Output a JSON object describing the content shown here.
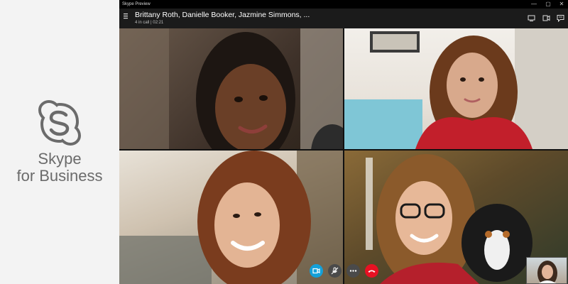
{
  "brand": {
    "line1": "Skype",
    "line2": "for Business",
    "logo_icon": "skype-logo-icon",
    "text_color": "#6b6b6b"
  },
  "window": {
    "app_name": "Skype Preview",
    "minimize": "—",
    "maximize": "▢",
    "close": "✕"
  },
  "call": {
    "title": "Brittany Roth, Danielle Booker, Jazmine Simmons, ...",
    "status": "4 in call | 02:21",
    "header_icons": [
      "screen-share-icon",
      "camera-switch-icon",
      "chat-icon"
    ]
  },
  "controls": [
    {
      "name": "video-toggle-button",
      "icon": "video-camera-icon",
      "color": "#14a0d8"
    },
    {
      "name": "mute-button",
      "icon": "microphone-off-icon",
      "color": "#4a4a4a"
    },
    {
      "name": "more-options-button",
      "icon": "more-dots-icon",
      "color": "#4a4a4a"
    },
    {
      "name": "hang-up-button",
      "icon": "phone-hangup-icon",
      "color": "#e81123"
    }
  ],
  "colors": {
    "accent": "#14a0d8",
    "hangup": "#e81123",
    "titlebar": "#000000"
  }
}
